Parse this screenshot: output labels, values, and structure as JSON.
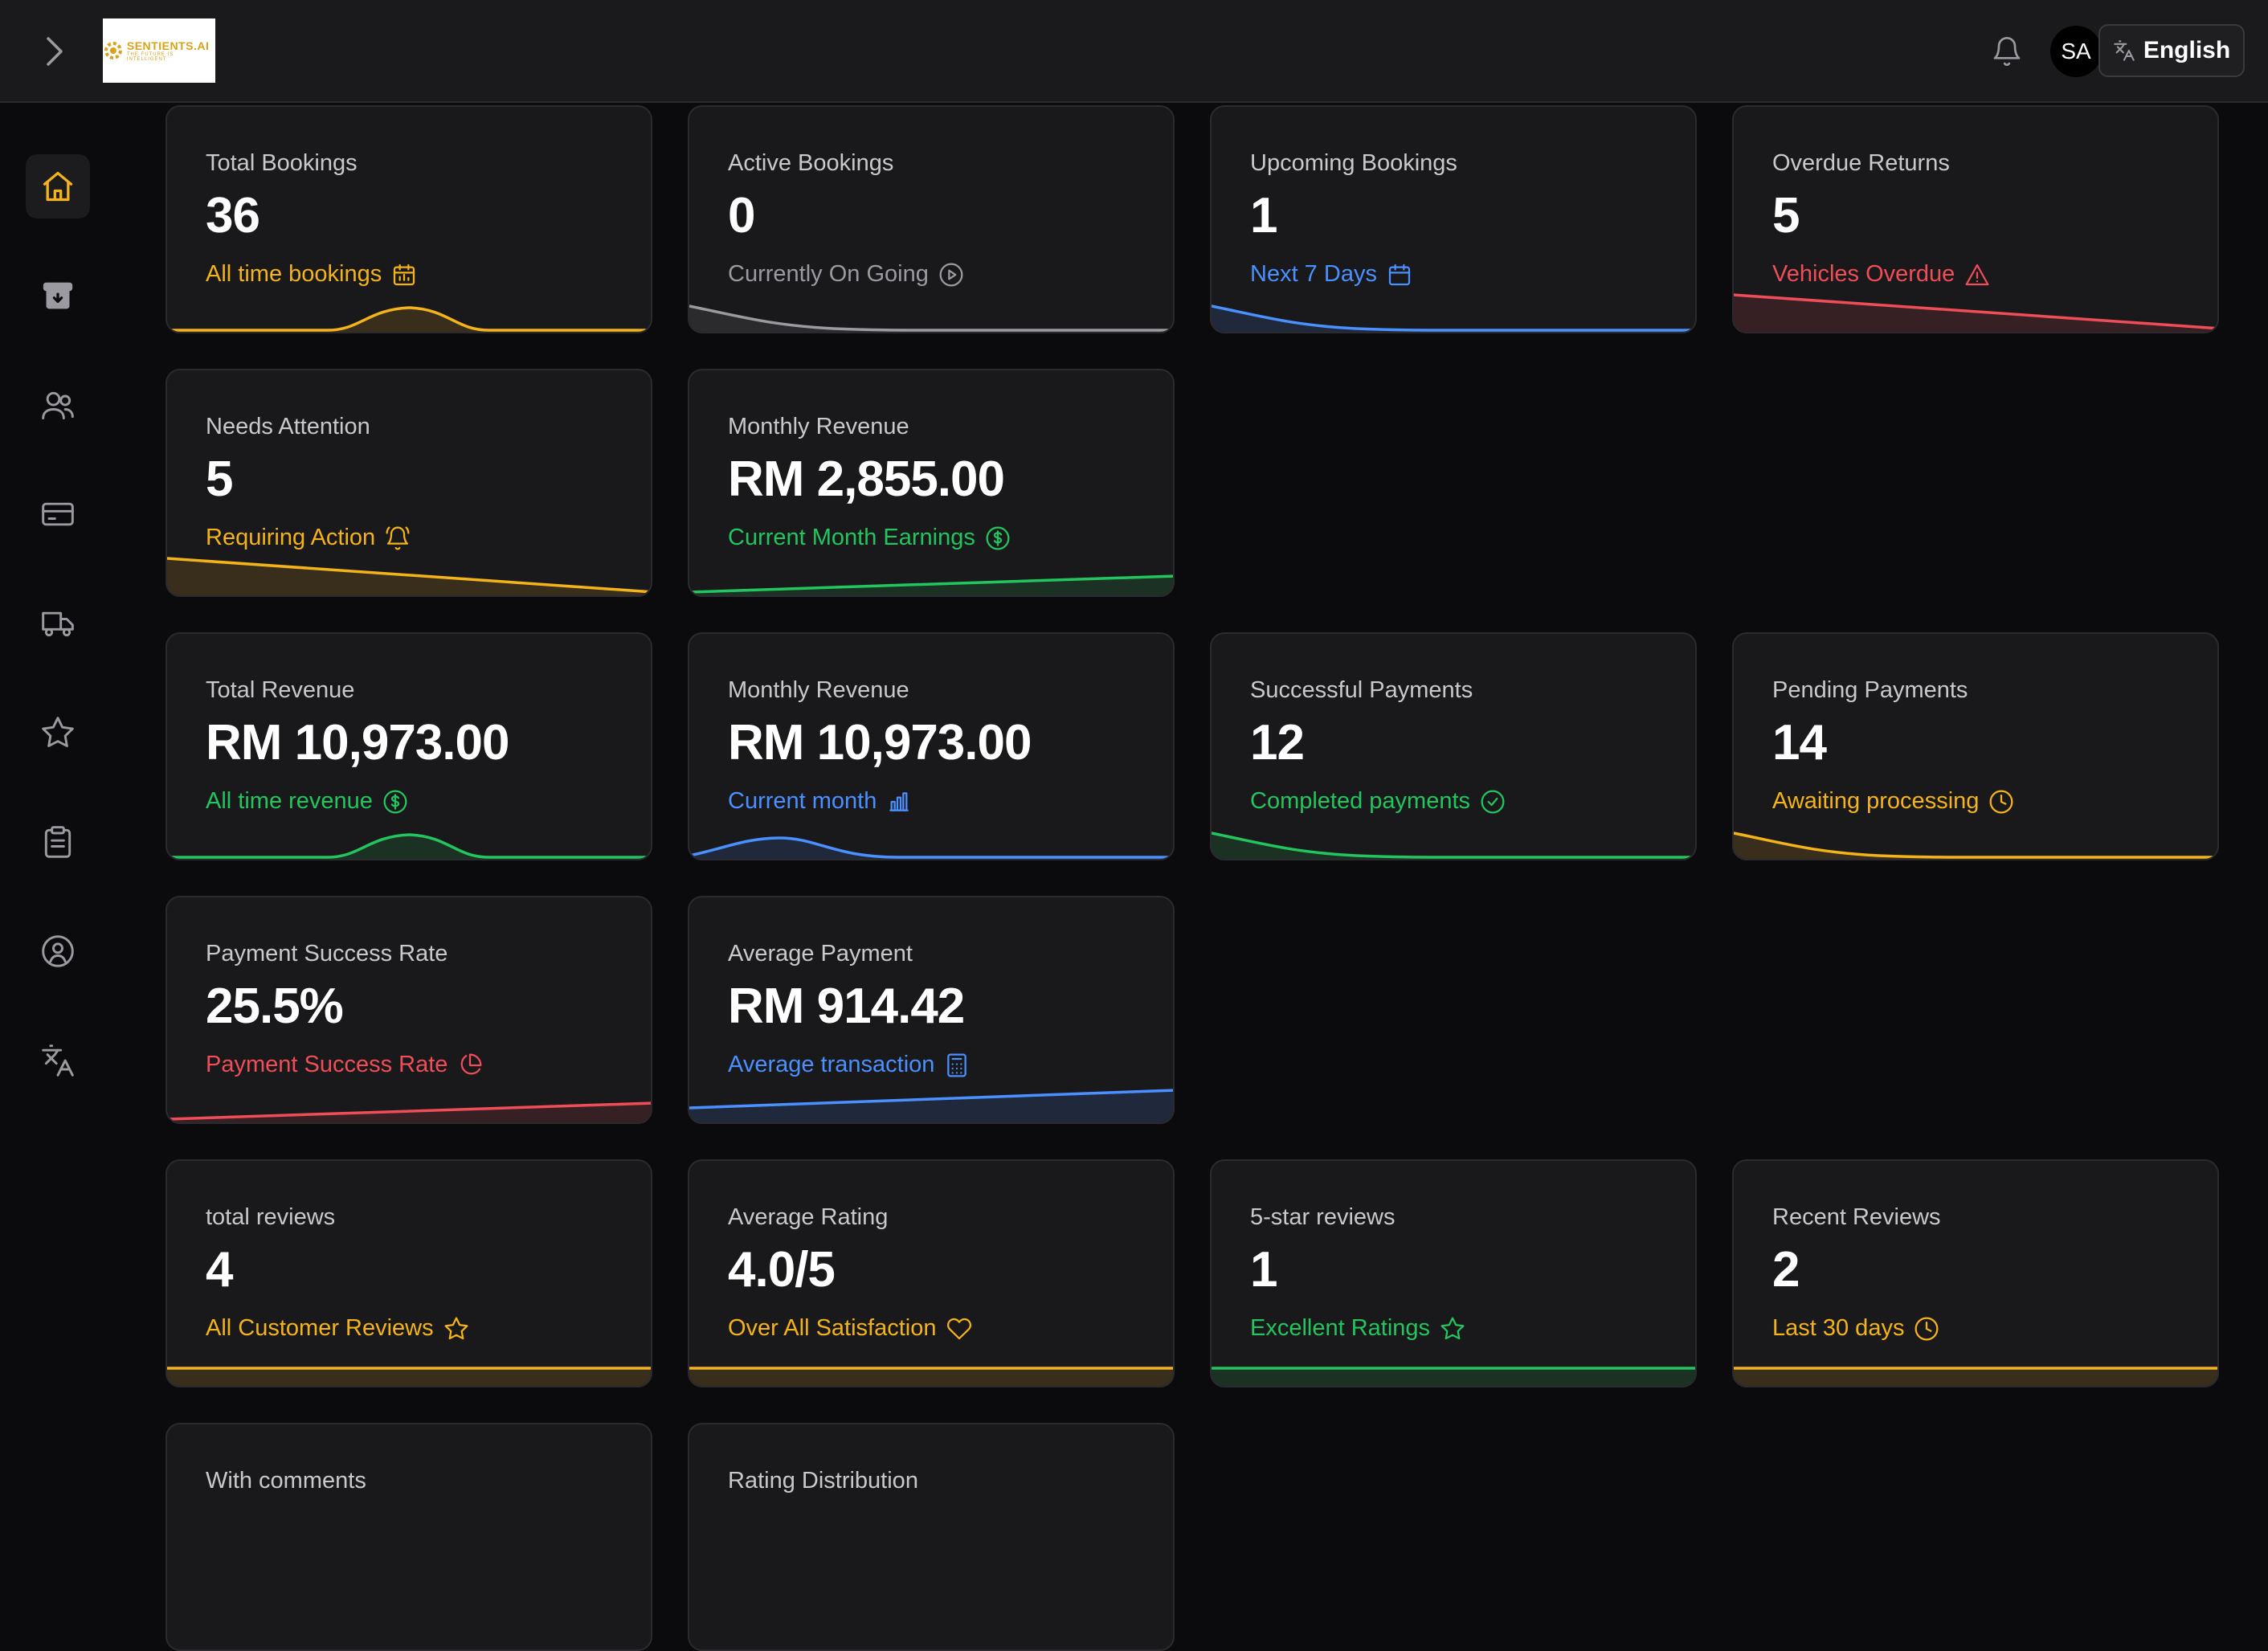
{
  "topbar": {
    "logo_text": "SENTIENTS.AI",
    "logo_sub": "THE FUTURE IS INTELLIGENT",
    "avatar_initials": "SA",
    "language_label": "English"
  },
  "sidebar": {
    "items": [
      {
        "icon": "home-icon",
        "active": true
      },
      {
        "icon": "archive-icon"
      },
      {
        "icon": "users-icon"
      },
      {
        "icon": "credit-card-icon"
      },
      {
        "icon": "truck-icon"
      },
      {
        "icon": "star-icon"
      },
      {
        "icon": "clipboard-icon"
      },
      {
        "icon": "user-circle-icon"
      },
      {
        "icon": "translate-icon"
      }
    ]
  },
  "colors": {
    "yellow": "#f5b31a",
    "gray": "#9a9aa0",
    "blue": "#4a90ff",
    "red": "#ef4d58",
    "green": "#22c55e",
    "card_bg": "#19191b",
    "page_bg": "#0b0b0d"
  },
  "cards": [
    {
      "title": "Total Bookings",
      "value": "36",
      "sub": "All time bookings",
      "sub_icon": "calendar-chart-icon",
      "color": "#f5b31a",
      "spark": "bump"
    },
    {
      "title": "Active Bookings",
      "value": "0",
      "sub": "Currently On Going",
      "sub_icon": "play-circle-icon",
      "color": "#9a9aa0",
      "spark": "decline-left"
    },
    {
      "title": "Upcoming Bookings",
      "value": "1",
      "sub": "Next 7 Days",
      "sub_icon": "calendar-icon",
      "color": "#4a90ff",
      "spark": "decline-left"
    },
    {
      "title": "Overdue Returns",
      "value": "5",
      "sub": "Vehicles Overdue",
      "sub_icon": "warning-icon",
      "color": "#ef4d58",
      "spark": "down-line"
    },
    {
      "title": "Needs Attention",
      "value": "5",
      "sub": "Requiring Action",
      "sub_icon": "bell-ring-icon",
      "color": "#f5b31a",
      "spark": "down-line"
    },
    {
      "title": "Monthly Revenue",
      "value": "RM 2,855.00",
      "sub": "Current Month Earnings",
      "sub_icon": "dollar-circle-icon",
      "color": "#22c55e",
      "spark": "up-line"
    },
    {
      "title": "Total Revenue",
      "value": "RM 10,973.00",
      "sub": "All time revenue",
      "sub_icon": "dollar-circle-icon",
      "color": "#22c55e",
      "spark": "bump"
    },
    {
      "title": "Monthly Revenue",
      "value": "RM 10,973.00",
      "sub": "Current month",
      "sub_icon": "bar-chart-icon",
      "color": "#4a90ff",
      "spark": "bump-left"
    },
    {
      "title": "Successful Payments",
      "value": "12",
      "sub": "Completed payments",
      "sub_icon": "check-circle-icon",
      "color": "#22c55e",
      "spark": "decline-left"
    },
    {
      "title": "Pending Payments",
      "value": "14",
      "sub": "Awaiting processing",
      "sub_icon": "clock-icon",
      "color": "#f5b31a",
      "spark": "decline-left"
    },
    {
      "title": "Payment Success Rate",
      "value": "25.5%",
      "sub": "Payment Success Rate",
      "sub_icon": "pie-chart-icon",
      "color": "#ef4d58",
      "spark": "up-line"
    },
    {
      "title": "Average Payment",
      "value": "RM 914.42",
      "sub": "Average transaction",
      "sub_icon": "calculator-icon",
      "color": "#4a90ff",
      "spark": "up-line-steep"
    },
    {
      "title": "total reviews",
      "value": "4",
      "sub": "All Customer Reviews",
      "sub_icon": "star-icon",
      "color": "#f5b31a",
      "spark": "flat"
    },
    {
      "title": "Average Rating",
      "value": "4.0/5",
      "sub": "Over All Satisfaction",
      "sub_icon": "heart-icon",
      "color": "#f5b31a",
      "spark": "flat"
    },
    {
      "title": "5-star reviews",
      "value": "1",
      "sub": "Excellent Ratings",
      "sub_icon": "star-icon",
      "color": "#22c55e",
      "spark": "flat"
    },
    {
      "title": "Recent Reviews",
      "value": "2",
      "sub": "Last 30 days",
      "sub_icon": "clock-icon",
      "color": "#f5b31a",
      "spark": "flat"
    },
    {
      "title": "With comments",
      "value": "",
      "sub": "",
      "sub_icon": "",
      "color": "#f5b31a",
      "spark": "none"
    },
    {
      "title": "Rating Distribution",
      "value": "",
      "sub": "",
      "sub_icon": "",
      "color": "#f5b31a",
      "spark": "none"
    }
  ]
}
